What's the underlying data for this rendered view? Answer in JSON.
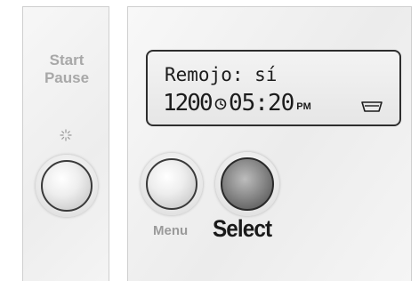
{
  "left_panel": {
    "start_label": "Start",
    "pause_label": "Pause",
    "indicator_icon": "led-indicator-icon"
  },
  "display": {
    "line1": "Remojo: sí",
    "temperature": "1200",
    "clock_icon": "clock-icon",
    "time": "05:20",
    "ampm": "PM",
    "tub_icon": "drum-icon"
  },
  "controls": {
    "menu_label": "Menu",
    "select_label": "Select"
  },
  "colors": {
    "panel": "#efefef",
    "label_muted": "#a8a8a8",
    "label_strong": "#1a1a1a",
    "lcd_bg": "#ececec",
    "lcd_text": "#1c1c1c"
  }
}
